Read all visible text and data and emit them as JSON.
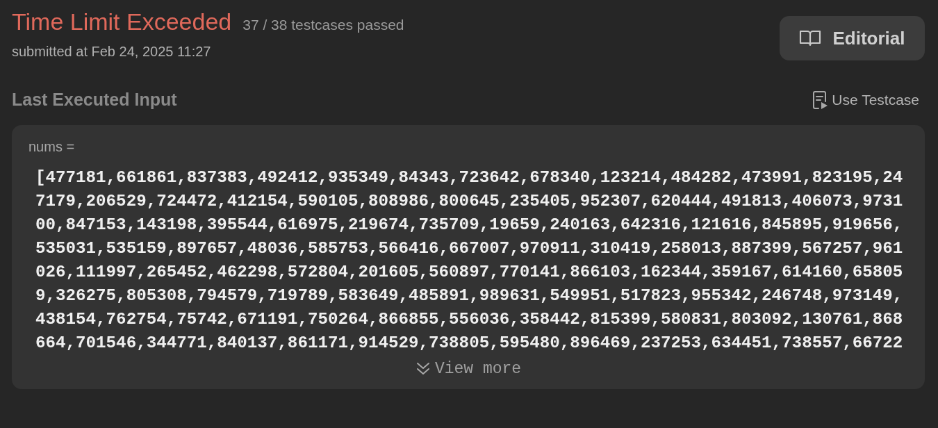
{
  "result": {
    "status": "Time Limit Exceeded",
    "passed": "37 / 38 testcases passed",
    "submitted": "submitted at Feb 24, 2025 11:27"
  },
  "editorial_button": {
    "label": "Editorial"
  },
  "section": {
    "title": "Last Executed Input",
    "action": "Use Testcase"
  },
  "input": {
    "name": "nums =",
    "lines": [
      "[477181,661861,837383,492412,935349,84343,723642,678340,123214,484282,473991,823195,24",
      "7179,206529,724472,412154,590105,808986,800645,235405,952307,620444,491813,406073,9731",
      "00,847153,143198,395544,616975,219674,735709,19659,240163,642316,121616,845895,919656,",
      "535031,535159,897657,48036,585753,566416,667007,970911,310419,258013,887399,567257,961",
      "026,111997,265452,462298,572804,201605,560897,770141,866103,162344,359167,614160,65805",
      "9,326275,805308,794579,719789,583649,485891,989631,549951,517823,955342,246748,973149,",
      "438154,762754,75742,671191,750264,866855,556036,358442,815399,580831,803092,130761,868",
      "664,701546,344771,840137,861171,914529,738805,595480,896469,237253,634451,738557,66722"
    ],
    "view_more": "View more"
  }
}
